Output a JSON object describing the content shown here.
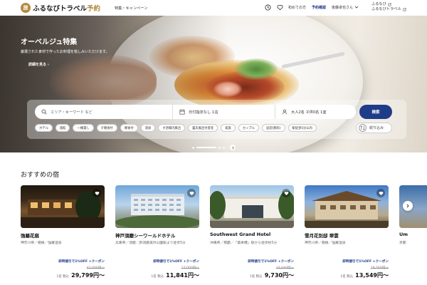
{
  "header": {
    "logo_mark": "旅",
    "logo_text": "ふるなびトラベル",
    "logo_accent": "予約",
    "nav_label": "特集・キャンペーン",
    "first_time_label": "初めての方",
    "reservation_label": "予約確認",
    "user_label": "後藤卓也さん",
    "ext_link_1": "ふるなび",
    "ext_link_2": "ふるなびトラベル"
  },
  "hero": {
    "title": "オーベルジュ特集",
    "subtitle": "厳選された食材で作ったお料理を愉しみいただけます。",
    "more_label": "詳細を見る"
  },
  "search": {
    "keyword_placeholder": "エリア・キーワード など",
    "date_value": "日付指定なし 1泊",
    "guests_value": "大人2名 子供0名 1室",
    "button_label": "検索",
    "chips": [
      "ホテル",
      "旅館",
      "一棟貸し",
      "夕朝食付",
      "朝食付",
      "温泉",
      "大浴場内風呂",
      "露天風呂付客室",
      "家族",
      "カップル",
      "送迎(無料)",
      "駅徒歩5分以内"
    ],
    "refine_label": "絞り込み"
  },
  "recommend": {
    "title": "おすすめの宿",
    "cards": [
      {
        "name": "強羅花扇",
        "location": "神奈川県／箱根／強羅温泉",
        "promo": "即時値引で1%OFF +クーポン",
        "strike": "42,000円〜",
        "price_note": "1名 税込",
        "price": "29,799円〜"
      },
      {
        "name": "神戸須磨シーワールドホテル",
        "location": "兵庫県／須磨／JR須磨海浜公園駅より徒歩5分",
        "promo": "即時値引で1%OFF +クーポン",
        "strike": "17,000円〜",
        "price_note": "1名 税込",
        "price": "11,841円〜"
      },
      {
        "name": "Southwest Grand Hotel",
        "location": "沖縄県／那覇／「美栄橋」駅から徒歩約5分",
        "promo": "即時値引で1%OFF +クーポン",
        "strike": "14,040円〜",
        "price_note": "1名 税込",
        "price": "9,730円〜"
      },
      {
        "name": "雪月花別邸 翠雲",
        "location": "神奈川県／箱根／強羅温泉",
        "promo": "即時値引で1%OFF +クーポン",
        "strike": "18,560円〜",
        "price_note": "1名 税込",
        "price": "13,549円〜"
      }
    ],
    "partial_card": {
      "name": "Um",
      "location": "京都"
    }
  },
  "colors": {
    "brand_gold": "#b08a3c",
    "brand_navy": "#1f3c88"
  }
}
